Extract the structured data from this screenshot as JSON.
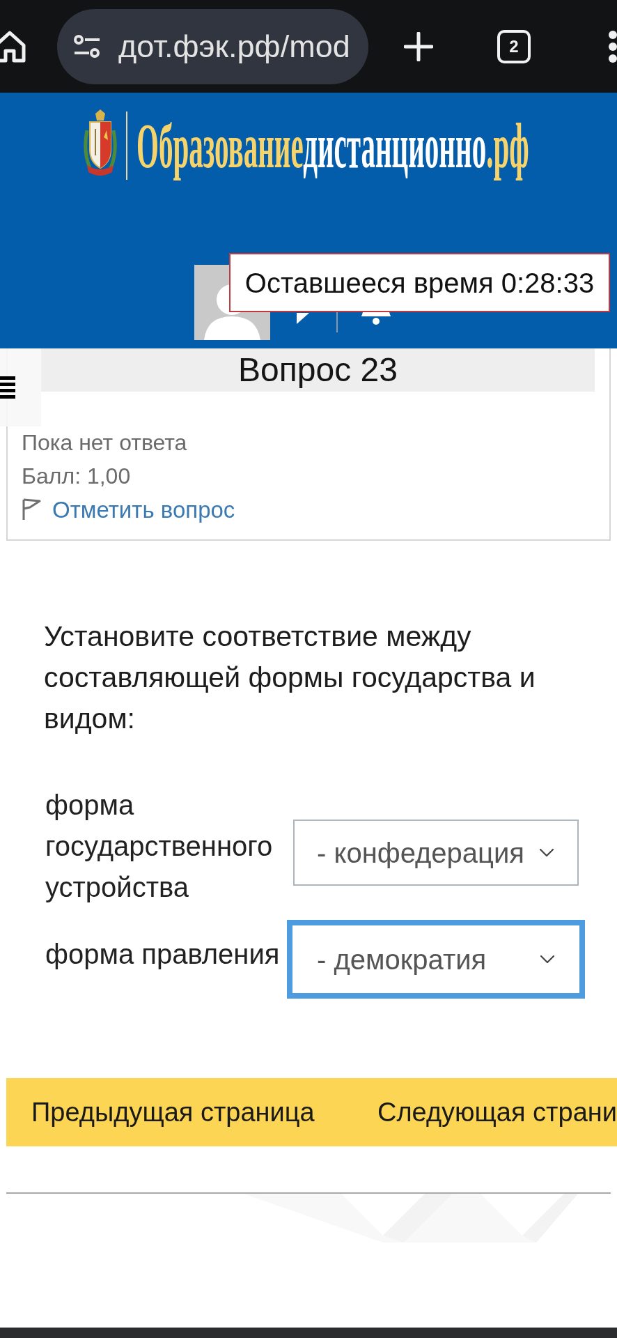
{
  "browser": {
    "url": "дот.фэк.рф/mod",
    "tab_count": "2"
  },
  "header": {
    "logo": [
      {
        "text": "Образование",
        "color": "#f6d36b"
      },
      {
        "text": "дистанционно",
        "color": "#ffffff"
      },
      {
        "text": ".рф",
        "color": "#f6d36b"
      }
    ],
    "timer": "Оставшееся время 0:28:33"
  },
  "question_info": {
    "title": "Вопрос 23",
    "status": "Пока нет ответа",
    "grade": "Балл: 1,00",
    "flag_link": "Отметить вопрос"
  },
  "question": {
    "text": "Установите соответствие между составляющей формы государства и видом:",
    "matches": [
      {
        "label": "форма государственного устройства",
        "value": "- конфедерация",
        "focused": false
      },
      {
        "label": "форма правления",
        "value": "- демократия",
        "focused": true
      }
    ]
  },
  "navigation": [
    "Предыдущая страница",
    "Следующая страни"
  ]
}
